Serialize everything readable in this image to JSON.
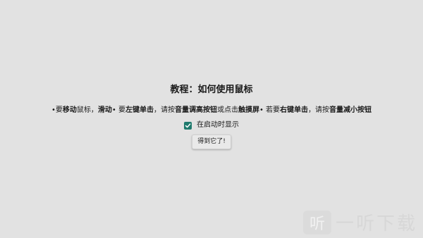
{
  "dialog": {
    "title": "教程：如何使用鼠标",
    "instructions": {
      "p1": "•要",
      "p2": "移动",
      "p3": "鼠标，",
      "p4": "滑动",
      "p5": "• 要",
      "p6": "左键单击",
      "p7": "，请按",
      "p8": "音量调高按钮",
      "p9": "或点击",
      "p10": "触摸屏",
      "p11": "• 若要",
      "p12": "右键单击",
      "p13": "，请按",
      "p14": "音量减小按钮"
    },
    "checkbox": {
      "label": "在启动时显示",
      "checked": true,
      "color": "#1f7a6d"
    },
    "button_label": "得到它了!"
  },
  "watermark": {
    "logo": "听",
    "text": "一听下载"
  },
  "colors": {
    "background": "#e2e2e2",
    "accent": "#1f7a6d"
  }
}
